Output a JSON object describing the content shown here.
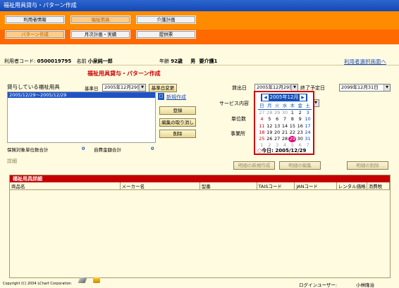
{
  "window": {
    "title": "福祉用具貸与・パターン作成"
  },
  "nav": {
    "row1": [
      "利用者情報",
      "福祉用具",
      "介護計画"
    ],
    "row2": [
      "パターン作成",
      "月次計画・実績",
      "提供票"
    ]
  },
  "user": {
    "code_label": "利用者コード:",
    "code": "0500019795",
    "name_label": "名前",
    "name": "小泉純一郎",
    "age_label": "年齢",
    "age": "92歳",
    "sex": "男",
    "care": "要介護1",
    "back_link": "利用者選択画面へ"
  },
  "section_title": "福祉用具貸与・パターン作成",
  "left": {
    "label": "貸与している福祉用具",
    "base_label": "基準日",
    "base_date": "2005年12月29日",
    "change_btn": "基準日変更",
    "new_link": "新規作成",
    "period": "2005/12/29～2005/12/29",
    "register": "登録",
    "undo": "編集の取り消し",
    "delete": "削除",
    "units_label": "保険対象単位数合計",
    "units_value": "0",
    "self_label": "自費金額合計",
    "self_value": "0"
  },
  "right": {
    "lend_label": "貸出日",
    "lend_date": "2005年12月29日",
    "end_label": "終了予定日",
    "end_date": "2099年12月31日",
    "service_label": "サービス内容",
    "unit_label": "単位数",
    "office_label": "事業所"
  },
  "calendar": {
    "month": "2005年12月",
    "prev": "◀",
    "next": "▶",
    "weekdays": [
      "日",
      "月",
      "火",
      "水",
      "木",
      "金",
      "土"
    ],
    "days": [
      [
        "27",
        "28",
        "29",
        "30",
        "1",
        "2",
        "3"
      ],
      [
        "4",
        "5",
        "6",
        "7",
        "8",
        "9",
        "10"
      ],
      [
        "11",
        "12",
        "13",
        "14",
        "15",
        "16",
        "17"
      ],
      [
        "18",
        "19",
        "20",
        "21",
        "22",
        "23",
        "24"
      ],
      [
        "25",
        "26",
        "27",
        "28",
        "29",
        "30",
        "31"
      ],
      [
        "1",
        "2",
        "3",
        "4",
        "5",
        "6",
        "7"
      ]
    ],
    "today_label": "今日: 2005/12/29"
  },
  "detail": {
    "label": "詳細",
    "new_btn": "明細の新規作成",
    "edit_btn": "明細の編集",
    "del_btn": "明細の削除",
    "table_title": "福祉用具詳細",
    "columns": [
      "商品名",
      "メーカー名",
      "型番",
      "TAISコード",
      "JANコード",
      "レンタル価格",
      "消費税"
    ]
  },
  "footer": {
    "copyright": "Copyright (C) 2004 LChart Corporation",
    "login_label": "ログインユーザー:",
    "login_user": "小林隆治"
  }
}
